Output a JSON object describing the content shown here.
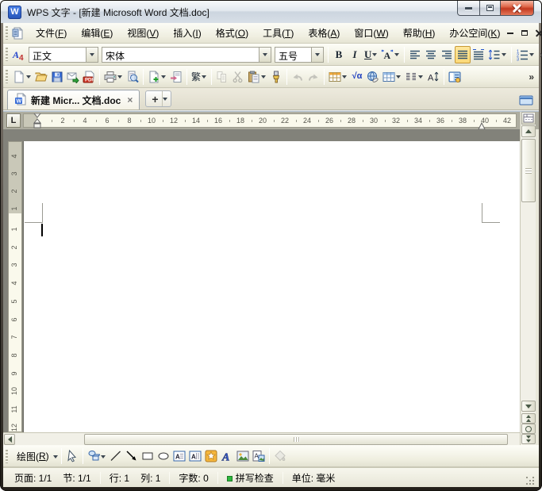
{
  "window": {
    "title": "WPS 文字 - [新建 Microsoft Word 文档.doc]",
    "logo_letter": "W"
  },
  "ui": {
    "more_glyph": "»"
  },
  "menu_bar": {
    "items": [
      {
        "label": "文件",
        "key": "F"
      },
      {
        "label": "编辑",
        "key": "E"
      },
      {
        "label": "视图",
        "key": "V"
      },
      {
        "label": "插入",
        "key": "I"
      },
      {
        "label": "格式",
        "key": "O"
      },
      {
        "label": "工具",
        "key": "T"
      },
      {
        "label": "表格",
        "key": "A"
      },
      {
        "label": "窗口",
        "key": "W"
      },
      {
        "label": "帮助",
        "key": "H"
      },
      {
        "label": "办公空间",
        "key": "K"
      }
    ]
  },
  "format_toolbar": {
    "items": [
      {
        "t": "icon",
        "icon": "styles-icon"
      },
      {
        "t": "combo",
        "name": "style-combo",
        "value": "正文"
      },
      {
        "t": "combo",
        "name": "font-combo",
        "value": "宋体"
      },
      {
        "t": "combo",
        "name": "size-combo",
        "value": "五号"
      },
      {
        "t": "sep"
      },
      {
        "t": "btn",
        "name": "bold-button",
        "glyph": "B"
      },
      {
        "t": "btn",
        "name": "italic-button",
        "glyph": "I"
      },
      {
        "t": "btn",
        "name": "underline-button",
        "glyph": "U",
        "dd": true
      },
      {
        "t": "btn",
        "name": "character-scale-button",
        "icon": "character-scale-icon",
        "dd": true
      },
      {
        "t": "sep"
      },
      {
        "t": "btn",
        "name": "align-left-button",
        "icon": "align-left-icon"
      },
      {
        "t": "btn",
        "name": "align-center-button",
        "icon": "align-center-icon"
      },
      {
        "t": "btn",
        "name": "align-right-button",
        "icon": "align-right-icon"
      },
      {
        "t": "btn",
        "name": "justify-button",
        "icon": "justify-icon",
        "active": true
      },
      {
        "t": "btn",
        "name": "distribute-button",
        "icon": "distribute-icon"
      },
      {
        "t": "btn",
        "name": "line-spacing-button",
        "icon": "line-spacing-icon",
        "dd": true
      },
      {
        "t": "sep"
      },
      {
        "t": "btn",
        "name": "numbering-button",
        "icon": "numbering-icon",
        "dd": true
      },
      {
        "t": "more",
        "name": "format-more-button"
      }
    ]
  },
  "standard_toolbar": {
    "items": [
      {
        "t": "btn",
        "name": "new-document-button",
        "icon": "new-document-icon",
        "dd": true
      },
      {
        "t": "btn",
        "name": "open-button",
        "icon": "open-folder-icon"
      },
      {
        "t": "btn",
        "name": "save-button",
        "icon": "save-icon"
      },
      {
        "t": "btn",
        "name": "send-email-button",
        "icon": "send-email-icon"
      },
      {
        "t": "btn",
        "name": "export-pdf-button",
        "icon": "export-pdf-icon"
      },
      {
        "t": "sep"
      },
      {
        "t": "btn",
        "name": "print-button",
        "icon": "print-icon",
        "dd": true
      },
      {
        "t": "btn",
        "name": "print-preview-button",
        "icon": "print-preview-icon"
      },
      {
        "t": "sep"
      },
      {
        "t": "btn",
        "name": "insert-page-button",
        "icon": "insert-page-icon",
        "dd": true
      },
      {
        "t": "btn",
        "name": "page-break-button",
        "icon": "page-break-icon"
      },
      {
        "t": "sep"
      },
      {
        "t": "btn",
        "name": "convert-traditional-button",
        "glyph": "繁",
        "dd": true
      },
      {
        "t": "sep"
      },
      {
        "t": "btn",
        "name": "copy-button",
        "icon": "copy-icon",
        "disabled": true
      },
      {
        "t": "btn",
        "name": "cut-button",
        "icon": "cut-icon",
        "disabled": true
      },
      {
        "t": "btn",
        "name": "paste-button",
        "icon": "paste-icon",
        "dd": true
      },
      {
        "t": "btn",
        "name": "format-painter-button",
        "icon": "format-painter-icon"
      },
      {
        "t": "sep"
      },
      {
        "t": "btn",
        "name": "undo-button",
        "icon": "undo-icon",
        "disabled": true
      },
      {
        "t": "btn",
        "name": "redo-button",
        "icon": "redo-icon",
        "disabled": true
      },
      {
        "t": "sep"
      },
      {
        "t": "btn",
        "name": "insert-table-button",
        "icon": "insert-table-icon",
        "dd": true
      },
      {
        "t": "btn",
        "name": "formula-button",
        "glyph": "√α"
      },
      {
        "t": "btn",
        "name": "hyperlink-button",
        "icon": "hyperlink-icon"
      },
      {
        "t": "btn",
        "name": "table-grid-button",
        "icon": "table-grid-icon",
        "dd": true
      },
      {
        "t": "btn",
        "name": "columns-button",
        "icon": "columns-icon",
        "dd": true
      },
      {
        "t": "btn",
        "name": "text-direction-button",
        "icon": "text-direction-icon"
      },
      {
        "t": "sep"
      },
      {
        "t": "btn",
        "name": "document-map-button",
        "icon": "document-map-icon"
      },
      {
        "t": "more",
        "name": "standard-more-button"
      }
    ]
  },
  "tab_bar": {
    "tab_label": "新建 Micr... 文档.doc",
    "close_glyph": "×",
    "new_tab_glyph": "+"
  },
  "ruler": {
    "tab_selector": "L",
    "horizontal_numbers": [
      2,
      4,
      6,
      8,
      10,
      12,
      14,
      16,
      18,
      20,
      22,
      24,
      26,
      28,
      30,
      32,
      34,
      36,
      38,
      40,
      42
    ],
    "vertical_margin_numbers": [
      4,
      3,
      2,
      1
    ],
    "vertical_page_numbers": [
      1,
      2,
      3,
      4,
      5,
      6,
      7,
      8,
      9,
      10,
      11,
      12
    ]
  },
  "drawing_toolbar": {
    "label": "绘图",
    "key": "R",
    "items": [
      {
        "t": "btn",
        "name": "select-object-button",
        "icon": "select-arrow-icon"
      },
      {
        "t": "sep"
      },
      {
        "t": "btn",
        "name": "autoshapes-button",
        "icon": "shapes-icon",
        "dd": true
      },
      {
        "t": "btn",
        "name": "line-button",
        "icon": "line-icon"
      },
      {
        "t": "btn",
        "name": "arrow-button",
        "icon": "arrow-icon"
      },
      {
        "t": "btn",
        "name": "rectangle-button",
        "icon": "rectangle-icon"
      },
      {
        "t": "btn",
        "name": "oval-button",
        "icon": "oval-icon"
      },
      {
        "t": "btn",
        "name": "text-box-button",
        "icon": "text-box-icon"
      },
      {
        "t": "btn",
        "name": "vertical-text-box-button",
        "icon": "vertical-text-box-icon"
      },
      {
        "t": "btn",
        "name": "insert-wordart-button",
        "icon": "insert-wordart-icon"
      },
      {
        "t": "btn",
        "name": "wordart-button",
        "icon": "wordart-icon"
      },
      {
        "t": "btn",
        "name": "insert-picture-button",
        "icon": "insert-picture-icon"
      },
      {
        "t": "btn",
        "name": "insert-clipart-button",
        "icon": "insert-clipart-icon"
      },
      {
        "t": "sep"
      },
      {
        "t": "btn",
        "name": "fill-color-button",
        "icon": "fill-color-icon",
        "disabled": true
      }
    ]
  },
  "status_bar": {
    "segments": [
      {
        "t": "text",
        "name": "page-indicator",
        "text": "页面: 1/1"
      },
      {
        "t": "text",
        "name": "section-indicator",
        "text": "节: 1/1"
      },
      {
        "t": "sep"
      },
      {
        "t": "text",
        "name": "line-indicator",
        "text": "行: 1"
      },
      {
        "t": "text",
        "name": "column-indicator",
        "text": "列: 1"
      },
      {
        "t": "sep"
      },
      {
        "t": "text",
        "name": "word-count-indicator",
        "text": "字数: 0"
      },
      {
        "t": "sep"
      },
      {
        "t": "text",
        "name": "spell-check-indicator",
        "text": "拼写检查",
        "dot": true,
        "clickable": true
      },
      {
        "t": "sep"
      },
      {
        "t": "text",
        "name": "unit-indicator",
        "text": "单位: 毫米"
      }
    ]
  },
  "colors": {
    "wps_blue": "#2f66cc",
    "close_button_red": "#c23a20",
    "active_toggle_bg": "#fbd978",
    "active_toggle_border": "#c79a37",
    "spell_indicator_green": "#2db83d",
    "workspace_gray": "#82827a",
    "ruler_ivory": "#faf9ec"
  }
}
